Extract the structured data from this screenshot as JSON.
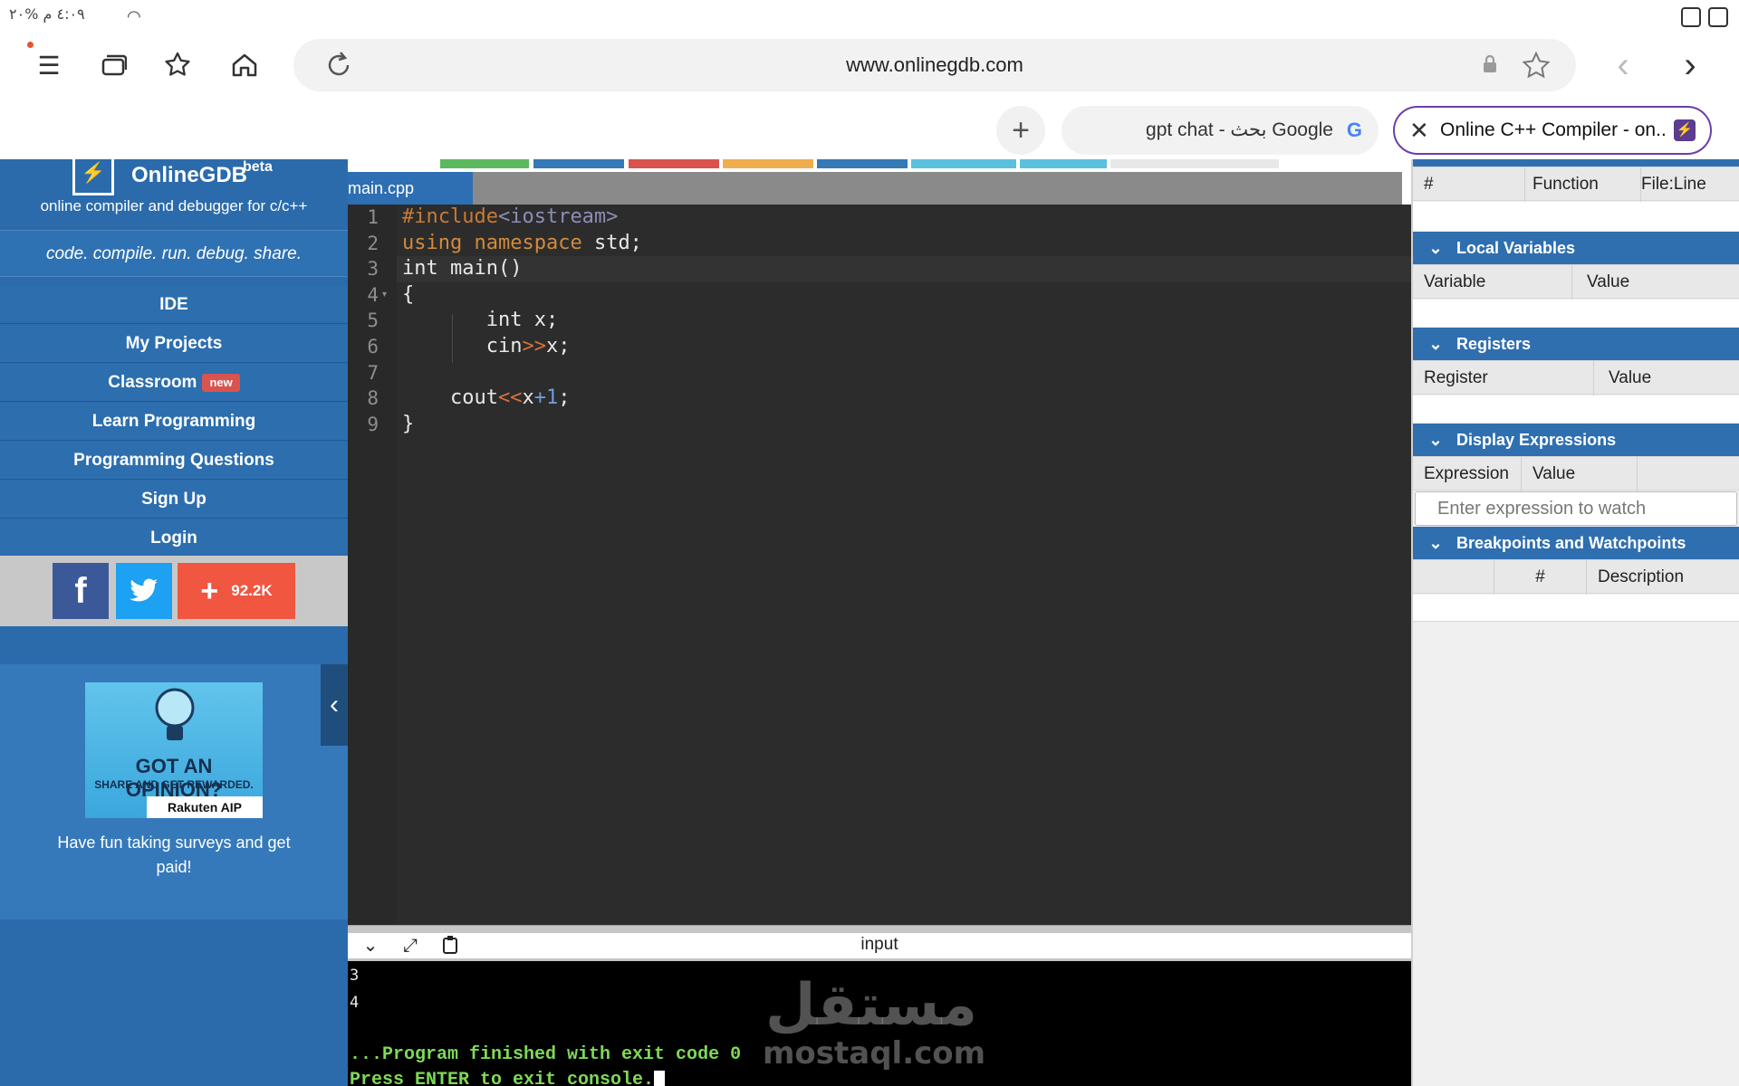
{
  "status_bar": {
    "text": "٤:٠٩ م  %٢٠"
  },
  "browser": {
    "url": "www.onlinegdb.com",
    "tabs": [
      {
        "label": "gpt chat - بحث Google",
        "icon": "google-g"
      },
      {
        "label": "Online C++ Compiler - on...",
        "icon": "onlinegdb-icon",
        "active": true
      }
    ]
  },
  "sidebar": {
    "brand": "OnlineGDB",
    "beta": "beta",
    "tagline": "online compiler and debugger for c/c++",
    "motto": "code. compile. run. debug. share.",
    "nav": [
      {
        "label": "IDE"
      },
      {
        "label": "My Projects"
      },
      {
        "label": "Classroom",
        "badge": "new"
      },
      {
        "label": "Learn Programming"
      },
      {
        "label": "Programming Questions"
      },
      {
        "label": "Sign Up"
      },
      {
        "label": "Login"
      }
    ],
    "share_count": "92.2K",
    "ad": {
      "title": "GOT AN OPINION?",
      "subtitle": "SHARE AND GET REWARDED.",
      "brand": "Rakuten AIP",
      "caption": "Have fun taking surveys and get paid!"
    }
  },
  "editor": {
    "filename": "main.cpp",
    "line_numbers": [
      "1",
      "2",
      "3",
      "4",
      "5",
      "6",
      "7",
      "8",
      "9"
    ]
  },
  "console": {
    "title": "input",
    "lines": [
      "3",
      "4"
    ],
    "finished": "...Program finished with exit code 0",
    "press": "Press ENTER to exit console."
  },
  "watermark": {
    "arabic": "مستقل",
    "latin": "mostaql.com"
  },
  "debug": {
    "stack_cols": [
      "#",
      "Function",
      "File:Line"
    ],
    "local_vars": {
      "title": "Local Variables",
      "cols": [
        "Variable",
        "Value"
      ]
    },
    "registers": {
      "title": "Registers",
      "cols": [
        "Register",
        "Value"
      ]
    },
    "display_expr": {
      "title": "Display Expressions",
      "cols": [
        "Expression",
        "Value"
      ],
      "placeholder": "Enter expression to watch"
    },
    "breakpoints": {
      "title": "Breakpoints and Watchpoints",
      "cols": [
        "#",
        "Description"
      ]
    }
  }
}
